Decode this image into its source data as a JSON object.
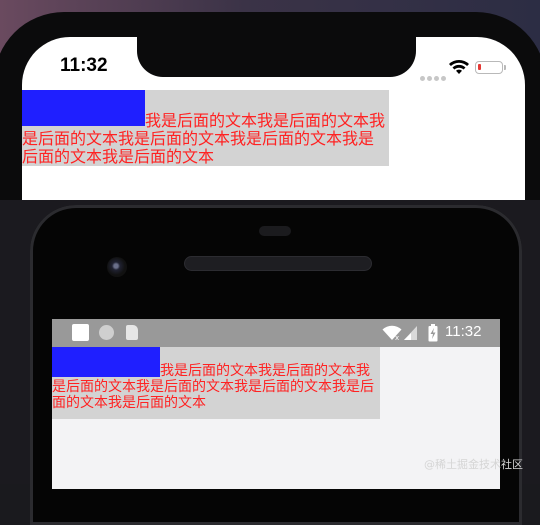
{
  "ios": {
    "status_time": "11:32",
    "demo_text": "我是后面的文本我是后面的文本我是后面的文本我是后面的文本我是后面的文本我是后面的文本我是后面的文本"
  },
  "android": {
    "status_time": "11:32",
    "demo_text": "我是后面的文本我是后面的文本我是后面的文本我是后面的文本我是后面的文本我是后面的文本我是后面的文本"
  },
  "colors": {
    "float_box": "#1f1fff",
    "text": "#ff2222",
    "container_bg": "#d3d3d3",
    "android_status_bar": "#999999"
  },
  "watermark": "@稀土掘金技术社区",
  "icons": [
    "wifi-icon",
    "battery-icon",
    "signal-icon",
    "notification-square-icon",
    "notification-circle-icon",
    "sd-card-icon"
  ]
}
